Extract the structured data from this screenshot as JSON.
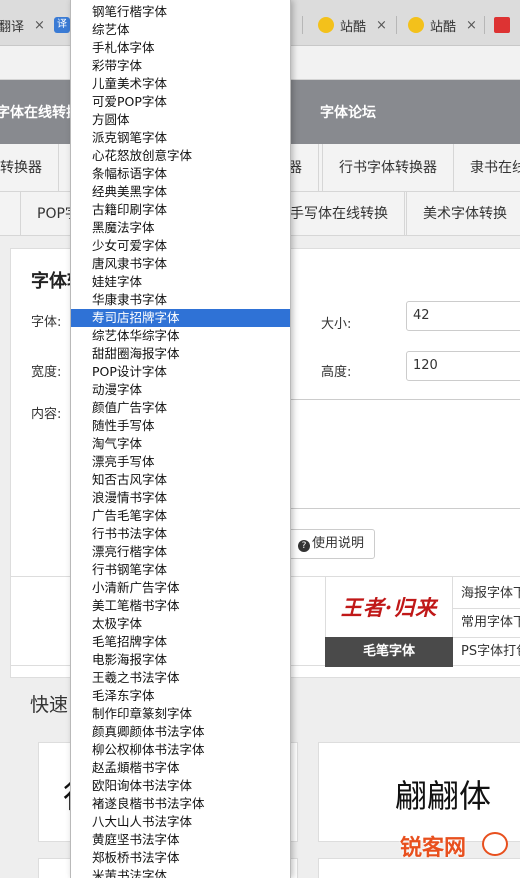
{
  "browser": {
    "tabs": [
      {
        "label": "翻译",
        "close": "×"
      },
      {
        "label": "译",
        "close": "×"
      },
      {
        "label": "站酷",
        "close": "×"
      },
      {
        "label": "站酷",
        "close": "×"
      },
      {
        "label": "",
        "close": "×"
      }
    ]
  },
  "nav_primary": {
    "items": [
      "字体在线转换",
      "字体论坛"
    ]
  },
  "nav_secondary": {
    "items": [
      "转换器",
      "器",
      "行书字体转换器",
      "隶书在线"
    ]
  },
  "nav_tertiary": {
    "items": [
      "POP字",
      "手写体在线转换",
      "美术字体转换"
    ]
  },
  "form": {
    "title": "字体转",
    "font_label": "字体:",
    "size_label": "大小:",
    "size_value": "42",
    "width_label": "宽度:",
    "height_label": "高度:",
    "height_value": "120",
    "content_label": "内容:",
    "help_button": "使用说明"
  },
  "categories": {
    "left_items": [
      "书",
      "载"
    ],
    "featured_image_text": "王者·归来",
    "featured_caption": "毛笔字体",
    "right_items": [
      "海报字体下",
      "常用字体下",
      "PS字体打包"
    ]
  },
  "quick": {
    "title": "快速",
    "card_left_text": "行",
    "card_right_text": "翩翩体"
  },
  "watermark": {
    "text": "锐客网"
  },
  "font_dropdown": {
    "selected_index": 17,
    "options": [
      "钢笔行楷字体",
      "综艺体",
      "手札体字体",
      "彩带字体",
      "儿童美术字体",
      "可爱POP字体",
      "方圆体",
      "派克钢笔字体",
      "心花怒放创意字体",
      "条幅标语字体",
      "经典美黑字体",
      "古籍印刷字体",
      "黑魔法字体",
      "少女可爱字体",
      "唐风隶书字体",
      "娃娃字体",
      "华康隶书字体",
      "寿司店招牌字体",
      "综艺体华综字体",
      "甜甜圈海报字体",
      "POP设计字体",
      "动漫字体",
      "颜值广告字体",
      "随性手写体",
      "淘气字体",
      "漂亮手写体",
      "知否古风字体",
      "浪漫情书字体",
      "广告毛笔字体",
      "行书书法字体",
      "漂亮行楷字体",
      "行书钢笔字体",
      "小清新广告字体",
      "美工笔楷书字体",
      "太极字体",
      "毛笔招牌字体",
      "电影海报字体",
      "王羲之书法字体",
      "毛泽东字体",
      "制作印章篆刻字体",
      "颜真卿颜体书法字体",
      "柳公权柳体书法字体",
      "赵孟頫楷书字体",
      "欧阳询体书法字体",
      "褚遂良楷书书法字体",
      "八大山人书法字体",
      "黄庭坚书法字体",
      "郑板桥书法字体",
      "米芾书法字体"
    ]
  }
}
